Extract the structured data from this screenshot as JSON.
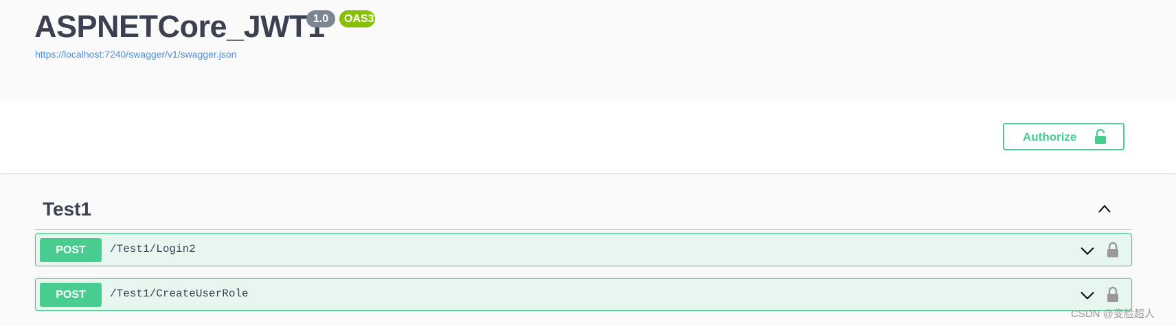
{
  "info": {
    "title": "ASPNETCore_JWT1",
    "version_badge": "1.0",
    "oas_badge": "OAS3",
    "spec_url": "https://localhost:7240/swagger/v1/swagger.json"
  },
  "auth": {
    "authorize_label": "Authorize",
    "icon": "unlocked-lock-icon"
  },
  "tag": {
    "name": "Test1",
    "toggle_icon": "chevron-up-icon"
  },
  "operations": [
    {
      "method": "POST",
      "path": "/Test1/Login2",
      "expand_icon": "chevron-down-icon",
      "lock_icon": "lock-icon"
    },
    {
      "method": "POST",
      "path": "/Test1/CreateUserRole",
      "expand_icon": "chevron-down-icon",
      "lock_icon": "lock-icon"
    }
  ],
  "watermark": "CSDN @变脸超人",
  "colors": {
    "post_green": "#49cc90",
    "post_bg": "#e8f6f0",
    "version_badge": "#7d8492",
    "oas_badge": "#89bf04",
    "link": "#4990e2",
    "text": "#3b4151"
  }
}
